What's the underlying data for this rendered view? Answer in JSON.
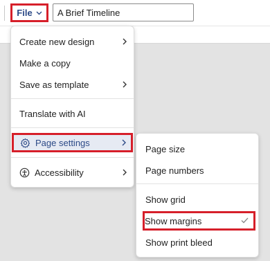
{
  "toolbar": {
    "file_label": "File",
    "document_title": "A Brief Timeline"
  },
  "file_menu": {
    "items": [
      {
        "label": "Create new design",
        "has_submenu": true
      },
      {
        "label": "Make a copy",
        "has_submenu": false
      },
      {
        "label": "Save as template",
        "has_submenu": true
      },
      {
        "label": "Translate with AI",
        "has_submenu": false
      },
      {
        "label": "Page settings",
        "has_submenu": true,
        "icon": "gear-icon",
        "highlighted": true
      },
      {
        "label": "Accessibility",
        "has_submenu": true,
        "icon": "accessibility-icon"
      }
    ]
  },
  "page_settings_menu": {
    "items": [
      {
        "label": "Page size"
      },
      {
        "label": "Page numbers"
      },
      {
        "label": "Show grid"
      },
      {
        "label": "Show margins",
        "checked": true,
        "highlighted": true
      },
      {
        "label": "Show print bleed"
      }
    ]
  },
  "colors": {
    "highlight_border": "#d61f2a",
    "brand_text": "#2c4a87",
    "hover_bg": "#e6eaf3",
    "canvas_bg": "#e3e3e3"
  }
}
